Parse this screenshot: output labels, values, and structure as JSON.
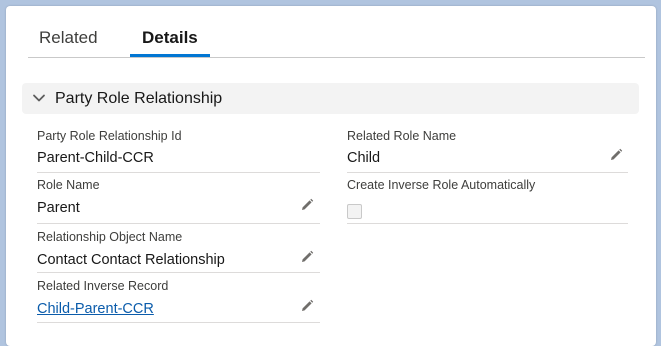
{
  "tabs": [
    {
      "label": "Related",
      "active": false
    },
    {
      "label": "Details",
      "active": true
    }
  ],
  "section": {
    "title": "Party Role Relationship",
    "expanded": true
  },
  "fields": {
    "relationship_id": {
      "label": "Party Role Relationship Id",
      "value": "Parent-Child-CCR"
    },
    "role_name": {
      "label": "Role Name",
      "value": "Parent"
    },
    "relationship_object_name": {
      "label": "Relationship Object Name",
      "value": "Contact Contact Relationship"
    },
    "related_inverse_record": {
      "label": "Related Inverse Record",
      "value": "Child-Parent-CCR"
    },
    "related_role_name": {
      "label": "Related Role Name",
      "value": "Child"
    },
    "create_inverse_role": {
      "label": "Create Inverse Role Automatically",
      "checked": false
    }
  },
  "icons": {
    "edit": "pencil-icon",
    "chevron": "chevron-down-icon"
  },
  "colors": {
    "accent": "#0176d3",
    "link": "#0b5cab",
    "section_bg": "#f3f3f3",
    "page_bg": "#b0c4df"
  }
}
